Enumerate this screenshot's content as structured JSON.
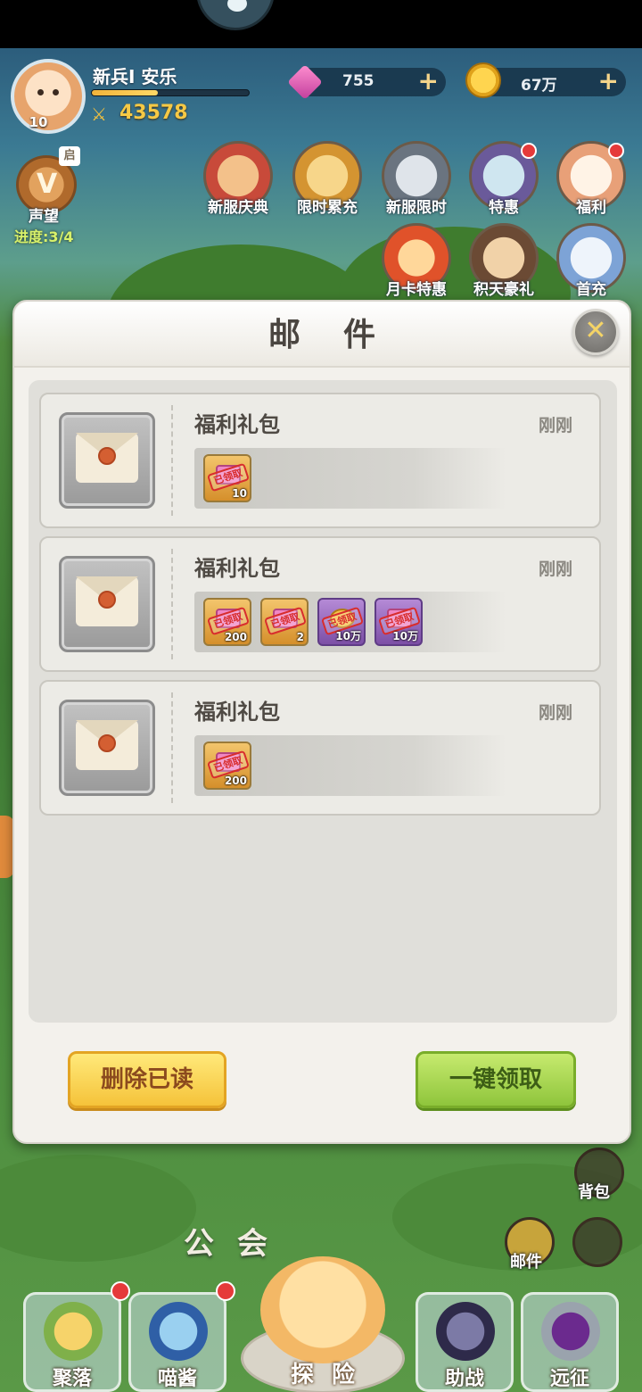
{
  "hud": {
    "player_name": "新兵I 安乐",
    "level": "10",
    "power": "43578",
    "xp_progress": 0.42,
    "gems": "755",
    "coins": "67万",
    "prestige": {
      "label": "声望",
      "tag": "启",
      "progress": "进度:3/4"
    }
  },
  "activities": [
    {
      "label": "新服庆典"
    },
    {
      "label": "限时累充"
    },
    {
      "label": "新服限时"
    },
    {
      "label": "特惠"
    },
    {
      "label": "福利"
    },
    {
      "label": "月卡特惠"
    },
    {
      "label": "积天豪礼"
    },
    {
      "label": "首充"
    }
  ],
  "mail_panel": {
    "title": "邮件",
    "close_icon": "close-icon",
    "items": [
      {
        "title": "福利礼包",
        "time": "刚刚",
        "rewards": [
          {
            "qty": "10",
            "type": "gift",
            "stamp": "已领取"
          }
        ]
      },
      {
        "title": "福利礼包",
        "time": "刚刚",
        "rewards": [
          {
            "qty": "200",
            "type": "gift",
            "stamp": "已领取"
          },
          {
            "qty": "2",
            "type": "gift",
            "stamp": "已领取"
          },
          {
            "qty": "10万",
            "type": "coin",
            "stamp": "已领取"
          },
          {
            "qty": "10万",
            "type": "gift",
            "stamp": "已领取"
          }
        ]
      },
      {
        "title": "福利礼包",
        "time": "刚刚",
        "rewards": [
          {
            "qty": "200",
            "type": "gift",
            "stamp": "已领取"
          }
        ]
      }
    ],
    "delete_read_label": "删除已读",
    "claim_all_label": "一键领取"
  },
  "scene": {
    "guild_label": "公会",
    "backpack_label": "背包",
    "mail_label": "邮件"
  },
  "bottom_nav": [
    {
      "label": "聚落"
    },
    {
      "label": "喵酱"
    },
    {
      "label": "探险"
    },
    {
      "label": "助战"
    },
    {
      "label": "远征"
    }
  ],
  "colors": {
    "panel_bg": "#f3f1ec",
    "delete_button": "#f5c33a",
    "claim_button": "#8fc53c",
    "stamp_red": "#d82d2d",
    "badge_red": "#e53a3a"
  }
}
